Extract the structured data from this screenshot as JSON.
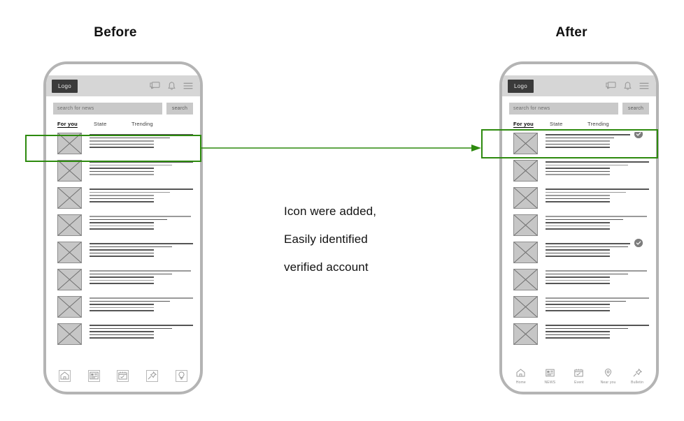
{
  "titles": {
    "before": "Before",
    "after": "After"
  },
  "caption": {
    "line1": "Icon were added,",
    "line2": "Easily identified",
    "line3": "verified account"
  },
  "colors": {
    "highlight_green": "#2d8a0e",
    "frame_gray": "#b4b4b4",
    "header_gray": "#d6d6d6",
    "logo_dark": "#3a3a3a",
    "thumb_gray": "#c6c6c6",
    "badge_gray": "#7d7d7d",
    "line_dark": "#555555",
    "line_light": "#9a9a9a"
  },
  "phone": {
    "header": {
      "logo_label": "Logo",
      "icons": [
        "chat-bubbles-icon",
        "bell-icon",
        "hamburger-menu-icon"
      ]
    },
    "search": {
      "placeholder": "search for news",
      "button_label": "search"
    },
    "tabs": [
      {
        "label": "For you",
        "active": true
      },
      {
        "label": "State",
        "active": false
      },
      {
        "label": "Trending",
        "active": false
      }
    ]
  },
  "before_phone": {
    "feed_rows": [
      {
        "lines": [
          100,
          78,
          62,
          62,
          62
        ],
        "shades": [
          "dark",
          "dark",
          "light",
          "dark",
          "dark"
        ],
        "verified": false
      },
      {
        "lines": [
          100,
          80,
          62,
          62,
          62
        ],
        "shades": [
          "dark",
          "light",
          "dark",
          "dark",
          "light"
        ],
        "verified": false
      },
      {
        "lines": [
          100,
          78,
          62,
          62,
          62
        ],
        "shades": [
          "dark",
          "light",
          "light",
          "dark",
          "dark"
        ],
        "verified": false
      },
      {
        "lines": [
          98,
          75,
          62,
          62,
          62
        ],
        "shades": [
          "light",
          "dark",
          "dark",
          "light",
          "dark"
        ],
        "verified": false
      },
      {
        "lines": [
          100,
          80,
          62,
          62,
          62
        ],
        "shades": [
          "dark",
          "dark",
          "dark",
          "dark",
          "dark"
        ],
        "verified": false
      },
      {
        "lines": [
          98,
          80,
          62,
          62,
          62
        ],
        "shades": [
          "light",
          "dark",
          "dark",
          "light",
          "dark"
        ],
        "verified": false
      },
      {
        "lines": [
          100,
          78,
          62,
          62,
          62
        ],
        "shades": [
          "light",
          "dark",
          "dark",
          "light",
          "dark"
        ],
        "verified": false
      },
      {
        "lines": [
          100,
          80,
          62,
          62,
          62
        ],
        "shades": [
          "dark",
          "dark",
          "dark",
          "dark",
          "dark"
        ],
        "verified": false
      }
    ],
    "bottom_nav": [
      {
        "icon": "home-icon",
        "label": "",
        "boxed": true
      },
      {
        "icon": "newspaper-icon",
        "label": "",
        "boxed": true
      },
      {
        "icon": "calendar-icon",
        "label": "",
        "boxed": true
      },
      {
        "icon": "pin-icon",
        "label": "",
        "boxed": true
      },
      {
        "icon": "bulb-icon",
        "label": "",
        "boxed": true
      }
    ]
  },
  "after_phone": {
    "feed_rows": [
      {
        "lines": [
          82,
          66,
          62,
          62,
          62
        ],
        "shades": [
          "dark",
          "dark",
          "light",
          "dark",
          "dark"
        ],
        "verified": true
      },
      {
        "lines": [
          100,
          80,
          62,
          62,
          62
        ],
        "shades": [
          "dark",
          "light",
          "dark",
          "dark",
          "light"
        ],
        "verified": false
      },
      {
        "lines": [
          100,
          78,
          62,
          62,
          62
        ],
        "shades": [
          "dark",
          "light",
          "light",
          "dark",
          "dark"
        ],
        "verified": false
      },
      {
        "lines": [
          98,
          75,
          62,
          62,
          62
        ],
        "shades": [
          "light",
          "dark",
          "dark",
          "light",
          "dark"
        ],
        "verified": false
      },
      {
        "lines": [
          82,
          80,
          62,
          62,
          62
        ],
        "shades": [
          "dark",
          "dark",
          "dark",
          "dark",
          "dark"
        ],
        "verified": true
      },
      {
        "lines": [
          98,
          80,
          62,
          62,
          62
        ],
        "shades": [
          "light",
          "dark",
          "dark",
          "light",
          "dark"
        ],
        "verified": false
      },
      {
        "lines": [
          100,
          78,
          62,
          62,
          62
        ],
        "shades": [
          "light",
          "dark",
          "dark",
          "light",
          "dark"
        ],
        "verified": false
      },
      {
        "lines": [
          100,
          80,
          62,
          62,
          62
        ],
        "shades": [
          "dark",
          "dark",
          "dark",
          "dark",
          "dark"
        ],
        "verified": false
      }
    ],
    "bottom_nav": [
      {
        "icon": "home-icon",
        "label": "Home",
        "boxed": false
      },
      {
        "icon": "newspaper-icon",
        "label": "NEWS",
        "boxed": false
      },
      {
        "icon": "calendar-icon",
        "label": "Event",
        "boxed": false
      },
      {
        "icon": "location-pin-icon",
        "label": "Near you",
        "boxed": false
      },
      {
        "icon": "pin-icon",
        "label": "Bulletin",
        "boxed": false
      }
    ]
  }
}
